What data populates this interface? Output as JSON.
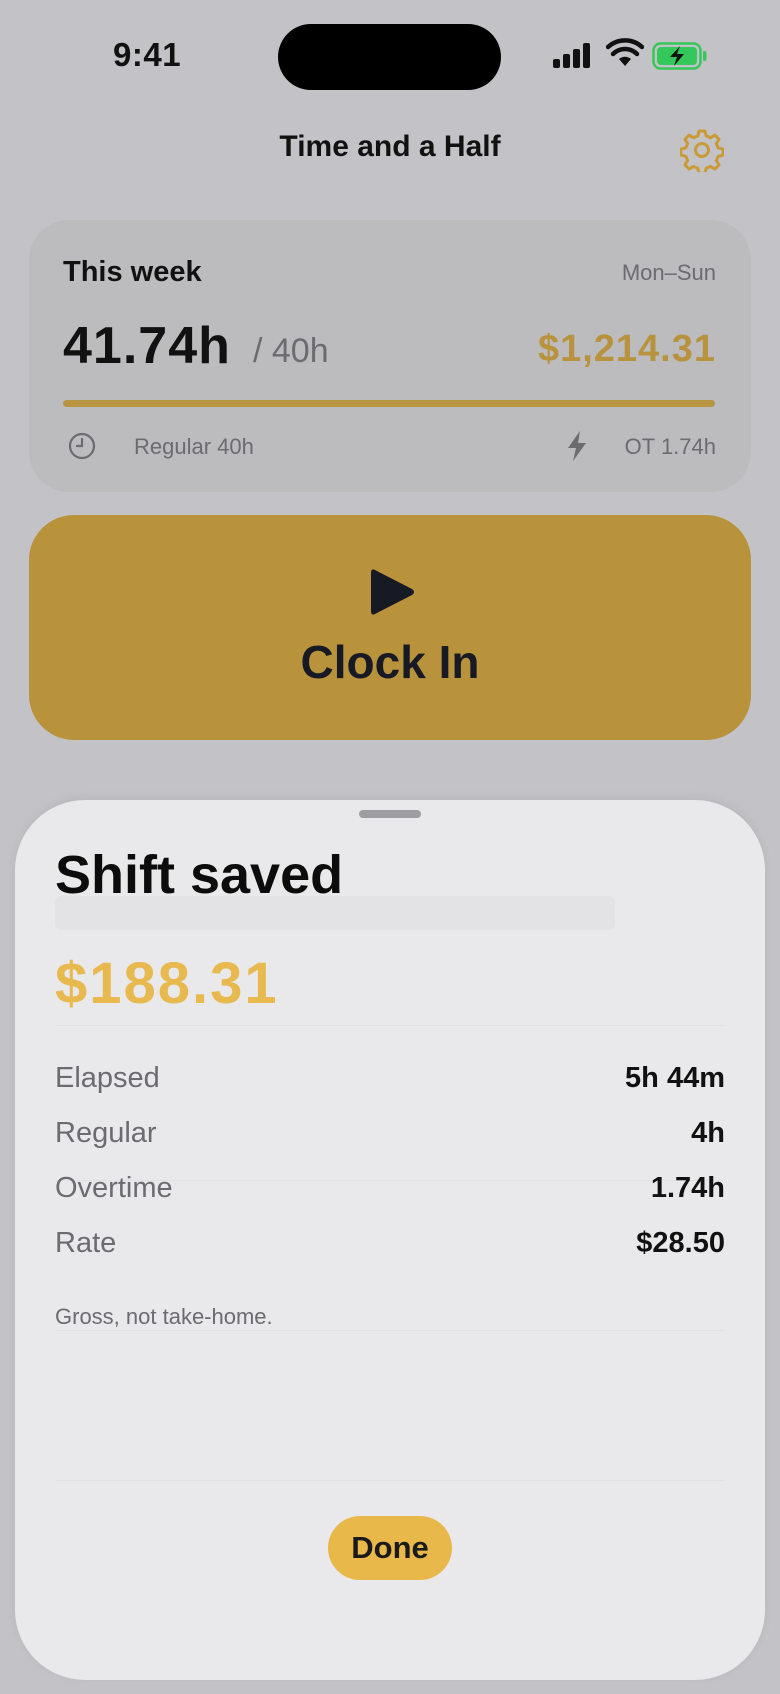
{
  "status_bar": {
    "time": "9:41"
  },
  "nav": {
    "title": "Time and a Half",
    "settings_icon": "gear-icon",
    "accent": "#B9933C"
  },
  "week": {
    "title": "This week",
    "range": "Mon–Sun",
    "hours": "41.74h",
    "target": "/ 40h",
    "earnings": "$1,214.31",
    "progress_fraction": 1.0,
    "regular": "Regular 40h",
    "overtime": "OT 1.74h"
  },
  "clock_in": {
    "label": "Clock In",
    "icon": "play-icon",
    "color": "#B9933C"
  },
  "sheet": {
    "title": "Shift saved",
    "amount": "$188.31",
    "amount_color": "#E7B94E",
    "rows": [
      {
        "label": "Elapsed",
        "value": "5h 44m"
      },
      {
        "label": "Regular",
        "value": "4h"
      },
      {
        "label": "Overtime",
        "value": "1.74h"
      },
      {
        "label": "Rate",
        "value": "$28.50"
      }
    ],
    "disclaimer": "Gross, not take-home.",
    "done_label": "Done"
  }
}
